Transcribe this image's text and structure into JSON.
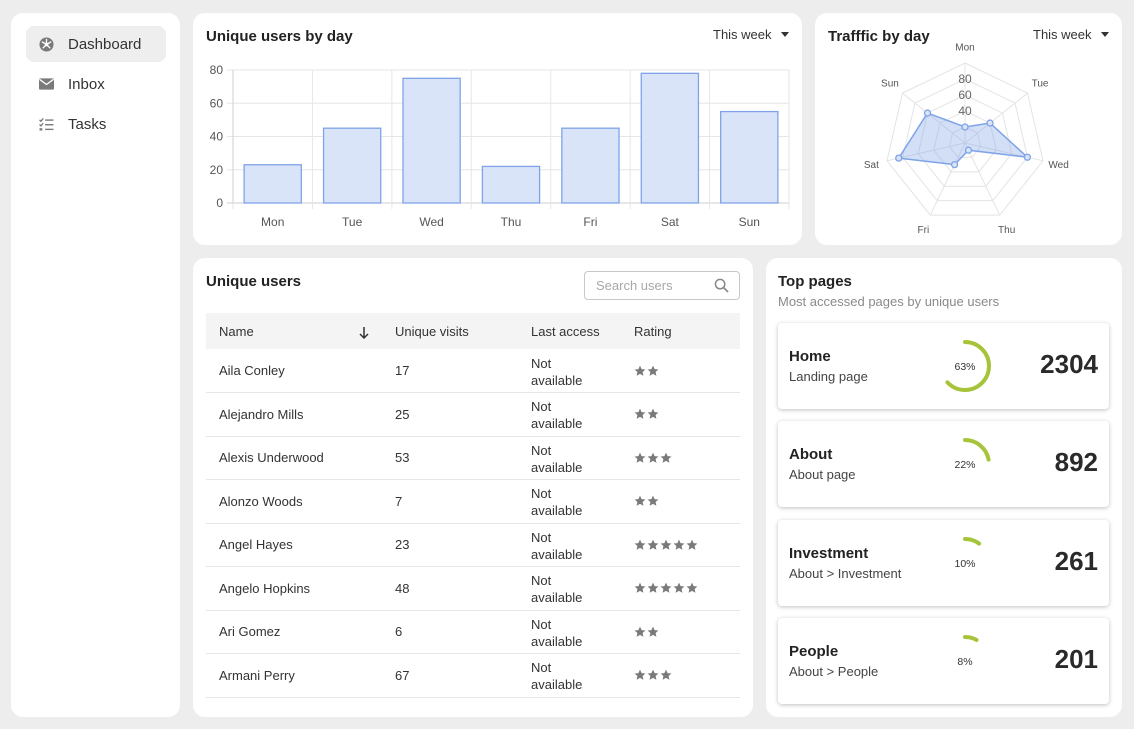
{
  "sidebar": {
    "items": [
      {
        "label": "Dashboard",
        "icon": "dashboard-icon",
        "active": true
      },
      {
        "label": "Inbox",
        "icon": "mail-icon",
        "active": false
      },
      {
        "label": "Tasks",
        "icon": "tasks-icon",
        "active": false
      }
    ]
  },
  "users_by_day": {
    "title": "Unique users by day",
    "range": "This week"
  },
  "traffic_by_day": {
    "title": "Trafffic by day",
    "range": "This week"
  },
  "chart_data": [
    {
      "type": "bar",
      "title": "Unique users by day",
      "categories": [
        "Mon",
        "Tue",
        "Wed",
        "Thu",
        "Fri",
        "Sat",
        "Sun"
      ],
      "values": [
        23,
        45,
        75,
        22,
        45,
        78,
        55
      ],
      "ylim": [
        0,
        80
      ],
      "yticks": [
        0,
        20,
        40,
        60,
        80
      ],
      "grid": true,
      "color": "#7fa3e8",
      "fill": "#dae4f8"
    },
    {
      "type": "radar",
      "title": "Trafffic by day",
      "categories": [
        "Mon",
        "Tue",
        "Wed",
        "Thu",
        "Fri",
        "Sat",
        "Sun"
      ],
      "values": [
        20,
        40,
        80,
        10,
        30,
        85,
        60
      ],
      "rticks": [
        40,
        60,
        80
      ],
      "rlim": [
        0,
        100
      ],
      "color": "#7fa3e8"
    }
  ],
  "unique_users": {
    "title": "Unique users",
    "search_placeholder": "Search users",
    "columns": [
      "Name",
      "Unique visits",
      "Last access",
      "Rating"
    ],
    "rows": [
      {
        "name": "Aila Conley",
        "visits": "17",
        "access_1": "Not",
        "access_2": "available",
        "rating": 2
      },
      {
        "name": "Alejandro Mills",
        "visits": "25",
        "access_1": "Not",
        "access_2": "available",
        "rating": 2
      },
      {
        "name": "Alexis Underwood",
        "visits": "53",
        "access_1": "Not",
        "access_2": "available",
        "rating": 3
      },
      {
        "name": "Alonzo Woods",
        "visits": "7",
        "access_1": "Not",
        "access_2": "available",
        "rating": 2
      },
      {
        "name": "Angel Hayes",
        "visits": "23",
        "access_1": "Not",
        "access_2": "available",
        "rating": 5
      },
      {
        "name": "Angelo Hopkins",
        "visits": "48",
        "access_1": "Not",
        "access_2": "available",
        "rating": 5
      },
      {
        "name": "Ari Gomez",
        "visits": "6",
        "access_1": "Not",
        "access_2": "available",
        "rating": 2
      },
      {
        "name": "Armani Perry",
        "visits": "67",
        "access_1": "Not",
        "access_2": "available",
        "rating": 3
      }
    ]
  },
  "top_pages": {
    "title": "Top pages",
    "subtitle": "Most accessed pages by unique users",
    "pages": [
      {
        "name": "Home",
        "path": "Landing page",
        "percent": 63,
        "percent_label": "63%",
        "count": "2304"
      },
      {
        "name": "About",
        "path": "About page",
        "percent": 22,
        "percent_label": "22%",
        "count": "892"
      },
      {
        "name": "Investment",
        "path": "About > Investment",
        "percent": 10,
        "percent_label": "10%",
        "count": "261"
      },
      {
        "name": "People",
        "path": "About > People",
        "percent": 8,
        "percent_label": "8%",
        "count": "201"
      }
    ],
    "accent": "#a6c43a"
  }
}
